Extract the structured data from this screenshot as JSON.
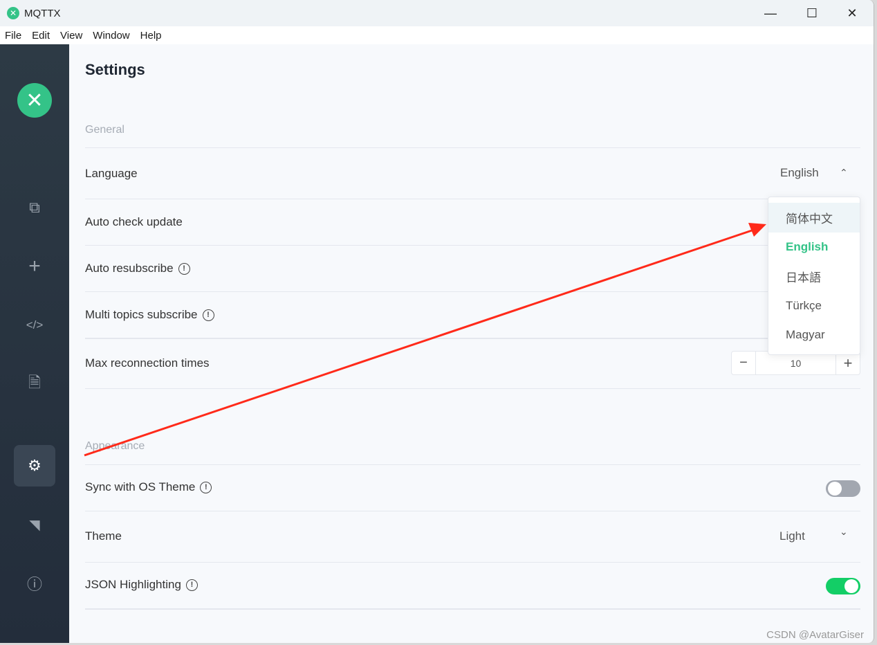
{
  "window": {
    "title": "MQTTX"
  },
  "menu": [
    "File",
    "Edit",
    "View",
    "Window",
    "Help"
  ],
  "sidebar": {
    "items": [
      "connections-icon",
      "plus-icon",
      "code-icon",
      "log-icon",
      "gear-icon",
      "rss-icon",
      "info-icon"
    ],
    "active": "gear-icon"
  },
  "settings": {
    "title": "Settings",
    "general": {
      "label": "General",
      "language": {
        "label": "Language",
        "value": "English",
        "options": [
          "简体中文",
          "English",
          "日本語",
          "Türkçe",
          "Magyar"
        ]
      },
      "auto_check_update": "Auto check update",
      "auto_resubscribe": "Auto resubscribe",
      "multi_topics": "Multi topics subscribe",
      "max_reconnect": {
        "label": "Max reconnection times",
        "value": "10",
        "minus": "−",
        "plus": "+"
      }
    },
    "appearance": {
      "label": "Appearance",
      "sync_os": {
        "label": "Sync with OS Theme",
        "on": false
      },
      "theme": {
        "label": "Theme",
        "value": "Light"
      },
      "json_highlight": {
        "label": "JSON Highlighting",
        "on": true
      }
    }
  },
  "colors": {
    "accent": "#34c388",
    "toggle_on": "#13ce66",
    "toggle_off": "#a2a7b0",
    "arrow": "#ff2a1a"
  },
  "watermark": "CSDN @AvatarGiser"
}
